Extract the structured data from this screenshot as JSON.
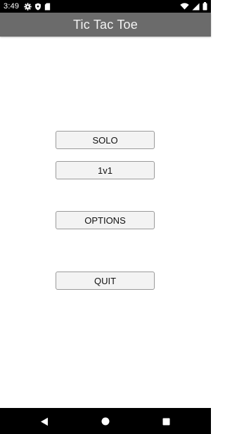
{
  "status_bar": {
    "time": "3:49",
    "icons_left": [
      "gear-icon",
      "shield-icon",
      "sim-card-icon"
    ],
    "icons_right": [
      "wifi-icon",
      "signal-icon",
      "battery-icon"
    ]
  },
  "app_bar": {
    "title": "Tic Tac Toe"
  },
  "menu": {
    "solo_label": "SOLO",
    "one_v_one_label": "1v1",
    "options_label": "OPTIONS",
    "quit_label": "QUIT"
  },
  "nav_bar": {
    "icons": [
      "back-icon",
      "home-icon",
      "recents-icon"
    ]
  },
  "colors": {
    "app_bar_bg": "#6b6b6b",
    "app_bar_text": "#f4f4f4",
    "button_bg": "#f3f3f3",
    "button_border": "#9a9a9a",
    "system_bar_bg": "#000000"
  }
}
